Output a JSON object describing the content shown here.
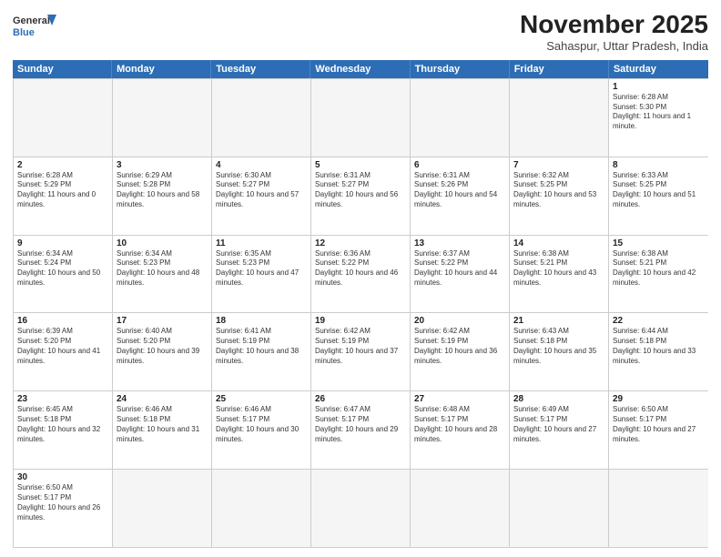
{
  "header": {
    "logo_line1": "General",
    "logo_line2": "Blue",
    "title": "November 2025",
    "subtitle": "Sahaspur, Uttar Pradesh, India"
  },
  "days_of_week": [
    "Sunday",
    "Monday",
    "Tuesday",
    "Wednesday",
    "Thursday",
    "Friday",
    "Saturday"
  ],
  "weeks": [
    [
      {
        "day": "",
        "empty": true
      },
      {
        "day": "",
        "empty": true
      },
      {
        "day": "",
        "empty": true
      },
      {
        "day": "",
        "empty": true
      },
      {
        "day": "",
        "empty": true
      },
      {
        "day": "",
        "empty": true
      },
      {
        "day": "1",
        "sunrise": "6:28 AM",
        "sunset": "5:30 PM",
        "daylight": "11 hours and 1 minute."
      }
    ],
    [
      {
        "day": "2",
        "sunrise": "6:28 AM",
        "sunset": "5:29 PM",
        "daylight": "11 hours and 0 minutes."
      },
      {
        "day": "3",
        "sunrise": "6:29 AM",
        "sunset": "5:28 PM",
        "daylight": "10 hours and 58 minutes."
      },
      {
        "day": "4",
        "sunrise": "6:30 AM",
        "sunset": "5:27 PM",
        "daylight": "10 hours and 57 minutes."
      },
      {
        "day": "5",
        "sunrise": "6:31 AM",
        "sunset": "5:27 PM",
        "daylight": "10 hours and 56 minutes."
      },
      {
        "day": "6",
        "sunrise": "6:31 AM",
        "sunset": "5:26 PM",
        "daylight": "10 hours and 54 minutes."
      },
      {
        "day": "7",
        "sunrise": "6:32 AM",
        "sunset": "5:25 PM",
        "daylight": "10 hours and 53 minutes."
      },
      {
        "day": "8",
        "sunrise": "6:33 AM",
        "sunset": "5:25 PM",
        "daylight": "10 hours and 51 minutes."
      }
    ],
    [
      {
        "day": "9",
        "sunrise": "6:34 AM",
        "sunset": "5:24 PM",
        "daylight": "10 hours and 50 minutes."
      },
      {
        "day": "10",
        "sunrise": "6:34 AM",
        "sunset": "5:23 PM",
        "daylight": "10 hours and 48 minutes."
      },
      {
        "day": "11",
        "sunrise": "6:35 AM",
        "sunset": "5:23 PM",
        "daylight": "10 hours and 47 minutes."
      },
      {
        "day": "12",
        "sunrise": "6:36 AM",
        "sunset": "5:22 PM",
        "daylight": "10 hours and 46 minutes."
      },
      {
        "day": "13",
        "sunrise": "6:37 AM",
        "sunset": "5:22 PM",
        "daylight": "10 hours and 44 minutes."
      },
      {
        "day": "14",
        "sunrise": "6:38 AM",
        "sunset": "5:21 PM",
        "daylight": "10 hours and 43 minutes."
      },
      {
        "day": "15",
        "sunrise": "6:38 AM",
        "sunset": "5:21 PM",
        "daylight": "10 hours and 42 minutes."
      }
    ],
    [
      {
        "day": "16",
        "sunrise": "6:39 AM",
        "sunset": "5:20 PM",
        "daylight": "10 hours and 41 minutes."
      },
      {
        "day": "17",
        "sunrise": "6:40 AM",
        "sunset": "5:20 PM",
        "daylight": "10 hours and 39 minutes."
      },
      {
        "day": "18",
        "sunrise": "6:41 AM",
        "sunset": "5:19 PM",
        "daylight": "10 hours and 38 minutes."
      },
      {
        "day": "19",
        "sunrise": "6:42 AM",
        "sunset": "5:19 PM",
        "daylight": "10 hours and 37 minutes."
      },
      {
        "day": "20",
        "sunrise": "6:42 AM",
        "sunset": "5:19 PM",
        "daylight": "10 hours and 36 minutes."
      },
      {
        "day": "21",
        "sunrise": "6:43 AM",
        "sunset": "5:18 PM",
        "daylight": "10 hours and 35 minutes."
      },
      {
        "day": "22",
        "sunrise": "6:44 AM",
        "sunset": "5:18 PM",
        "daylight": "10 hours and 33 minutes."
      }
    ],
    [
      {
        "day": "23",
        "sunrise": "6:45 AM",
        "sunset": "5:18 PM",
        "daylight": "10 hours and 32 minutes."
      },
      {
        "day": "24",
        "sunrise": "6:46 AM",
        "sunset": "5:18 PM",
        "daylight": "10 hours and 31 minutes."
      },
      {
        "day": "25",
        "sunrise": "6:46 AM",
        "sunset": "5:17 PM",
        "daylight": "10 hours and 30 minutes."
      },
      {
        "day": "26",
        "sunrise": "6:47 AM",
        "sunset": "5:17 PM",
        "daylight": "10 hours and 29 minutes."
      },
      {
        "day": "27",
        "sunrise": "6:48 AM",
        "sunset": "5:17 PM",
        "daylight": "10 hours and 28 minutes."
      },
      {
        "day": "28",
        "sunrise": "6:49 AM",
        "sunset": "5:17 PM",
        "daylight": "10 hours and 27 minutes."
      },
      {
        "day": "29",
        "sunrise": "6:50 AM",
        "sunset": "5:17 PM",
        "daylight": "10 hours and 27 minutes."
      }
    ],
    [
      {
        "day": "30",
        "sunrise": "6:50 AM",
        "sunset": "5:17 PM",
        "daylight": "10 hours and 26 minutes."
      },
      {
        "day": "",
        "empty": true
      },
      {
        "day": "",
        "empty": true
      },
      {
        "day": "",
        "empty": true
      },
      {
        "day": "",
        "empty": true
      },
      {
        "day": "",
        "empty": true
      },
      {
        "day": "",
        "empty": true
      }
    ]
  ],
  "labels": {
    "sunrise": "Sunrise:",
    "sunset": "Sunset:",
    "daylight": "Daylight:"
  },
  "colors": {
    "header_bg": "#2d6db5",
    "header_text": "#ffffff"
  }
}
